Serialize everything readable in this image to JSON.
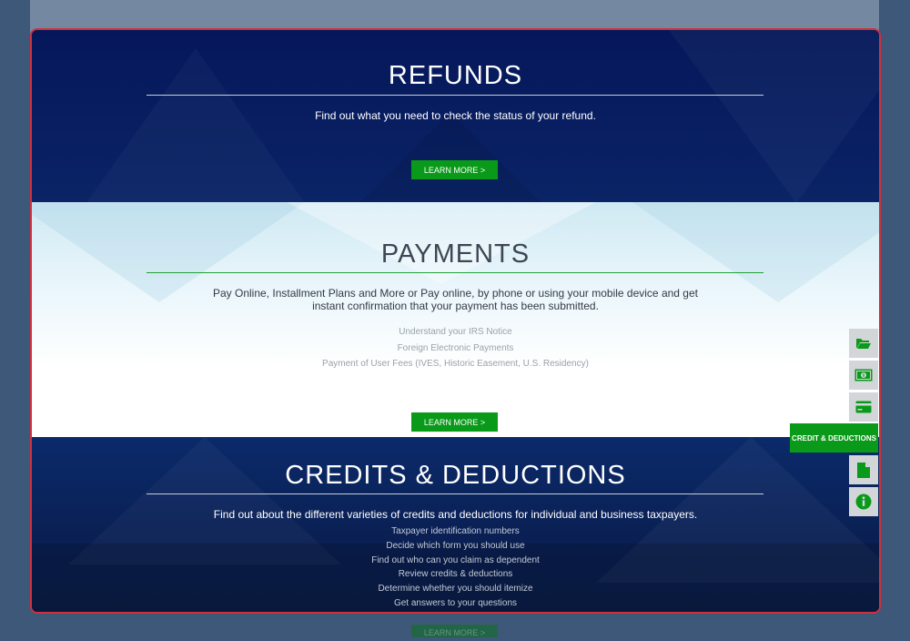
{
  "refunds": {
    "title": "REFUNDS",
    "description": "Find out what you need to check the status of your refund.",
    "button": "LEARN MORE >"
  },
  "payments": {
    "title": "PAYMENTS",
    "description_line1": "Pay Online, Installment Plans and More or Pay online, by phone or using your mobile device and get",
    "description_line2": "instant confirmation that your payment has been submitted.",
    "links": [
      "Understand your IRS Notice",
      "Foreign Electronic Payments",
      "Payment of User Fees (IVES, Historic Easement, U.S. Residency)"
    ],
    "button": "LEARN MORE >"
  },
  "credits": {
    "title": "CREDITS & DEDUCTIONS",
    "description": "Find out about the different varieties of credits and deductions for individual and business taxpayers.",
    "links": [
      "Taxpayer identification numbers",
      "Decide which form you should use",
      "Find out who can you claim as dependent",
      "Review credits & deductions",
      "Determine whether you should itemize",
      "Get answers to your questions"
    ],
    "button": "LEARN MORE >"
  },
  "dock": {
    "items": [
      {
        "icon": "folder-open-icon"
      },
      {
        "icon": "money-bill-icon"
      },
      {
        "icon": "credit-card-icon"
      },
      {
        "label": "CREDIT & DEDUCTIONS",
        "active": true
      },
      {
        "icon": "file-icon"
      },
      {
        "icon": "info-icon"
      }
    ]
  },
  "colors": {
    "accent_green": "#0a9a1a",
    "navy": "#05175a",
    "frame_border": "#d0303c"
  }
}
